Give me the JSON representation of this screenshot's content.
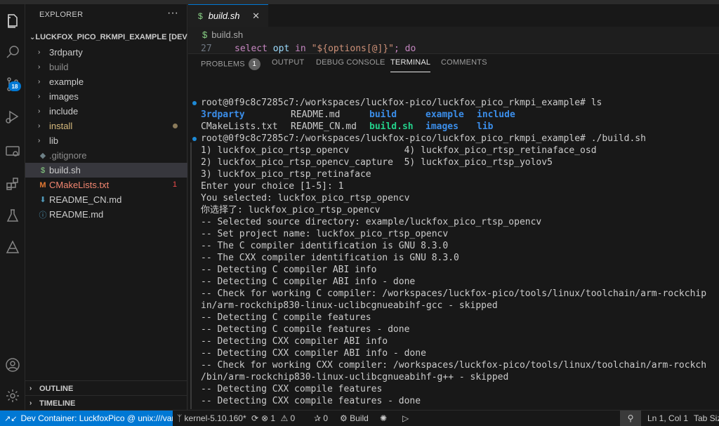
{
  "sidebar": {
    "title": "EXPLORER",
    "more": "···",
    "root_label": "LUCKFOX_PICO_RKMPI_EXAMPLE [DEV ...",
    "items": [
      {
        "label": "3rdparty",
        "type": "folder",
        "color": "#cccccc"
      },
      {
        "label": "build",
        "type": "folder",
        "color": "#8c8c8c"
      },
      {
        "label": "example",
        "type": "folder",
        "color": "#cccccc"
      },
      {
        "label": "images",
        "type": "folder",
        "color": "#cccccc"
      },
      {
        "label": "include",
        "type": "folder",
        "color": "#cccccc"
      },
      {
        "label": "install",
        "type": "folder",
        "color": "#d7ba7d"
      },
      {
        "label": "lib",
        "type": "folder",
        "color": "#cccccc"
      },
      {
        "label": ".gitignore",
        "type": "file",
        "color": "#8c8c8c"
      },
      {
        "label": "build.sh",
        "type": "file",
        "color": "#cccccc"
      },
      {
        "label": "CMakeLists.txt",
        "type": "file",
        "color": "#f48771",
        "errors": "1"
      },
      {
        "label": "README_CN.md",
        "type": "file",
        "color": "#cccccc"
      },
      {
        "label": "README.md",
        "type": "file",
        "color": "#cccccc"
      }
    ],
    "outline": "OUTLINE",
    "timeline": "TIMELINE"
  },
  "activity": {
    "scm_badge": "18"
  },
  "editor": {
    "tab_label": "build.sh",
    "tab_icon": "$",
    "breadcrumb": "build.sh",
    "line_number": "27",
    "code_keyword": "select",
    "code_var": "opt",
    "code_in": "in",
    "code_string": "\"${options[@]}\"",
    "code_end": "; do"
  },
  "panel": {
    "tabs": [
      {
        "label": "PROBLEMS",
        "badge": "1"
      },
      {
        "label": "OUTPUT"
      },
      {
        "label": "DEBUG CONSOLE"
      },
      {
        "label": "TERMINAL",
        "active": true
      },
      {
        "label": "COMMENTS"
      }
    ]
  },
  "terminal": {
    "prompt1": "root@0f9c8c7285c7:/workspaces/luckfox-pico/luckfox_pico_rkmpi_example# ls",
    "ls_row1": [
      {
        "text": "3rdparty",
        "style": "blue"
      },
      {
        "text": "README.md",
        "style": "plain"
      },
      {
        "text": "build",
        "style": "blue"
      },
      {
        "text": "example",
        "style": "blue"
      },
      {
        "text": "include",
        "style": "blue"
      }
    ],
    "ls_row2": [
      {
        "text": "CMakeLists.txt",
        "style": "plain"
      },
      {
        "text": "README_CN.md",
        "style": "plain"
      },
      {
        "text": "build.sh",
        "style": "green"
      },
      {
        "text": "images",
        "style": "blue"
      },
      {
        "text": "lib",
        "style": "blue"
      }
    ],
    "prompt2": "root@0f9c8c7285c7:/workspaces/luckfox-pico/luckfox_pico_rkmpi_example# ./build.sh",
    "lines": [
      "1) luckfox_pico_rtsp_opencv          4) luckfox_pico_rtsp_retinaface_osd",
      "2) luckfox_pico_rtsp_opencv_capture  5) luckfox_pico_rtsp_yolov5",
      "3) luckfox_pico_rtsp_retinaface",
      "Enter your choice [1-5]: 1",
      "You selected: luckfox_pico_rtsp_opencv",
      "你选择了: luckfox_pico_rtsp_opencv",
      "-- Selected source directory: example/luckfox_pico_rtsp_opencv",
      "-- Set project name: luckfox_pico_rtsp_opencv",
      "-- The C compiler identification is GNU 8.3.0",
      "-- The CXX compiler identification is GNU 8.3.0",
      "-- Detecting C compiler ABI info",
      "-- Detecting C compiler ABI info - done",
      "-- Check for working C compiler: /workspaces/luckfox-pico/tools/linux/toolchain/arm-rockchip",
      "in/arm-rockchip830-linux-uclibcgnueabihf-gcc - skipped",
      "-- Detecting C compile features",
      "-- Detecting C compile features - done",
      "-- Detecting CXX compiler ABI info",
      "-- Detecting CXX compiler ABI info - done",
      "-- Check for working CXX compiler: /workspaces/luckfox-pico/tools/linux/toolchain/arm-rockch",
      "/bin/arm-rockchip830-linux-uclibcgnueabihf-g++ - skipped",
      "-- Detecting CXX compile features",
      "-- Detecting CXX compile features - done"
    ]
  },
  "status": {
    "remote": "Dev Container: LuckfoxPico @ unix:///var...",
    "branch": "kernel-5.10.160*",
    "errors": "1",
    "warnings": "0",
    "ports": "0",
    "build": "Build",
    "position": "Ln 1, Col 1",
    "tabsize": "Tab Size"
  },
  "colors": {
    "accent": "#0078d4",
    "terminal_blue": "#3b8eea",
    "terminal_green": "#23d18b"
  }
}
